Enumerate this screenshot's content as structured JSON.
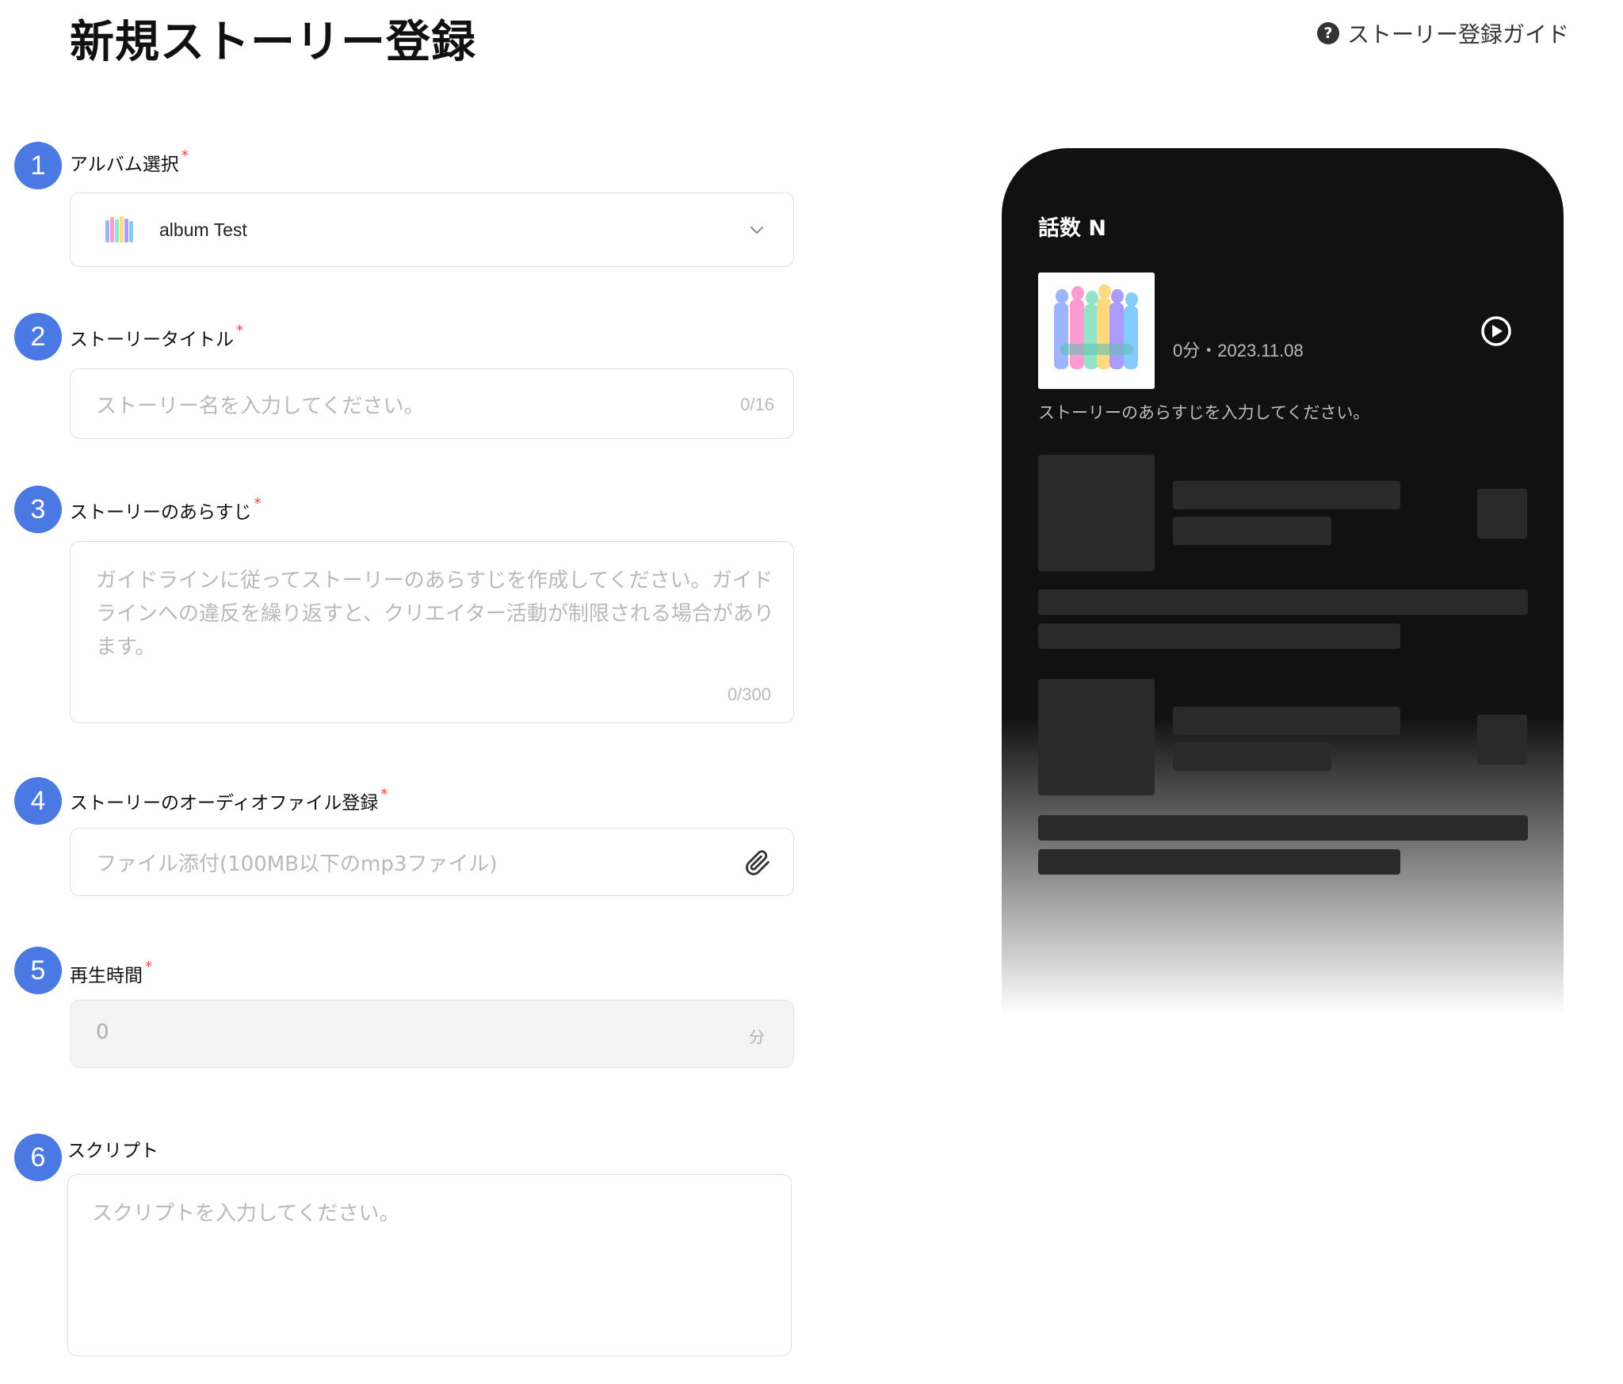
{
  "page": {
    "title": "新規ストーリー登録",
    "guide_label": "ストーリー登録ガイド",
    "guide_icon": "question-circle-icon"
  },
  "form": {
    "album": {
      "step": "1",
      "label": "アルバム選択",
      "required": "*",
      "selected": "album Test"
    },
    "title": {
      "step": "2",
      "label": "ストーリータイトル",
      "required": "*",
      "placeholder": "ストーリー名を入力してください。",
      "counter": "0/16"
    },
    "synopsis": {
      "step": "3",
      "label": "ストーリーのあらすじ",
      "required": "*",
      "placeholder": "ガイドラインに従ってストーリーのあらすじを作成してください。ガイドラインへの違反を繰り返すと、クリエイター活動が制限される場合があります。",
      "counter": "0/300"
    },
    "audio": {
      "step": "4",
      "label": "ストーリーのオーディオファイル登録",
      "required": "*",
      "placeholder": "ファイル添付(100MB以下のmp3ファイル)",
      "icon": "paperclip-icon"
    },
    "duration": {
      "step": "5",
      "label": "再生時間",
      "required": "*",
      "value": "0",
      "unit": "分"
    },
    "script": {
      "step": "6",
      "label": "スクリプト",
      "placeholder": "スクリプトを入力してください。"
    }
  },
  "preview": {
    "episode": "話数 N",
    "meta": "0分・2023.11.08",
    "synopsis": "ストーリーのあらすじを入力してください。",
    "play_icon": "play-circle-icon"
  },
  "colors": {
    "step_badge": "#4b79e4",
    "required": "#ff3d3d",
    "phone_bg": "#111111",
    "skeleton": "#2a2a2a"
  }
}
